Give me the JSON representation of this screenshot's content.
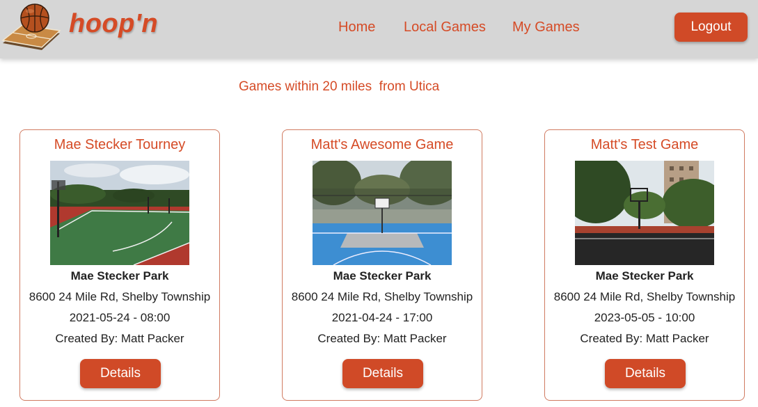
{
  "brand": {
    "name": "hoop'n",
    "logo_icon": "basketball-court-icon"
  },
  "nav": {
    "links": [
      {
        "label": "Home"
      },
      {
        "label": "Local Games"
      },
      {
        "label": "My Games"
      }
    ],
    "logout_label": "Logout"
  },
  "page": {
    "subtitle": "Games within 20 miles  from Utica"
  },
  "games": [
    {
      "title": "Mae Stecker Tourney",
      "park": "Mae Stecker Park",
      "address": "8600 24 Mile Rd, Shelby Township",
      "datetime": "2021-05-24 - 08:00",
      "created_by": "Created By: Matt Packer",
      "details_label": "Details"
    },
    {
      "title": "Matt's Awesome Game",
      "park": "Mae Stecker Park",
      "address": "8600 24 Mile Rd, Shelby Township",
      "datetime": "2021-04-24 - 17:00",
      "created_by": "Created By: Matt Packer",
      "details_label": "Details"
    },
    {
      "title": "Matt's Test Game",
      "park": "Mae Stecker Park",
      "address": "8600 24 Mile Rd, Shelby Township",
      "datetime": "2023-05-05 - 10:00",
      "created_by": "Created By: Matt Packer",
      "details_label": "Details"
    }
  ],
  "colors": {
    "accent": "#d54b26",
    "navbar": "#d6d6d6"
  }
}
